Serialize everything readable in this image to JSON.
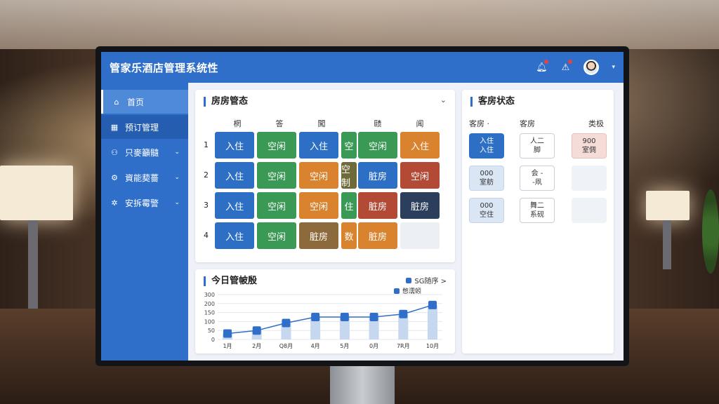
{
  "app": {
    "title": "管家乐酒店管理系统性"
  },
  "topbar": {
    "icons": [
      "bell-icon",
      "alarm-icon"
    ]
  },
  "sidebar": {
    "items": [
      {
        "icon": "home-icon",
        "label": "首页",
        "glyph": "⌂"
      },
      {
        "icon": "grid-icon",
        "label": "预订管理",
        "glyph": "▦"
      },
      {
        "icon": "users-icon",
        "label": "只麥籲髓",
        "glyph": "⚇"
      },
      {
        "icon": "settings-icon",
        "label": "資能葜薔",
        "glyph": "⚙"
      },
      {
        "icon": "gear-icon",
        "label": "安拆霉警",
        "glyph": "✲"
      }
    ]
  },
  "rooms": {
    "title": "房房管态",
    "columns": [
      "棢",
      "答",
      "闖",
      "赜",
      "闻"
    ],
    "rows": [
      {
        "num": "1",
        "cells": [
          "入住",
          "空闲",
          "入住",
          "空",
          "空闲",
          "入住"
        ]
      },
      {
        "num": "2",
        "cells": [
          "入住",
          "空闲",
          "空闲",
          "空制",
          "脏房",
          "空闲"
        ]
      },
      {
        "num": "3",
        "cells": [
          "入住",
          "空闲",
          "空闲",
          "住",
          "脏房",
          "脏房"
        ]
      },
      {
        "num": "4",
        "cells": [
          "入住",
          "空闲",
          "脏房",
          "数",
          "脏房",
          ""
        ]
      }
    ]
  },
  "status": {
    "title": "客房状态",
    "headers": [
      "客房 ·",
      "客房",
      "类极"
    ],
    "chips": [
      {
        "l1": "入住",
        "l2": "入住"
      },
      {
        "l1": "人二",
        "l2": "脚"
      },
      {
        "l1": "900",
        "l2": "室倜"
      },
      {
        "l1": "000",
        "l2": "室舫"
      },
      {
        "l1": "会 -",
        "l2": "-凧"
      },
      {
        "l1": "000",
        "l2": "空住"
      },
      {
        "l1": "舞二",
        "l2": "系砚"
      }
    ]
  },
  "chart": {
    "title": "今日管帔殷",
    "legend": "SG随序 >",
    "legend2": "憋濡蚓",
    "colors": {
      "line": "#2f6fc9",
      "bar": "#c6d8f0"
    }
  },
  "chart_data": {
    "type": "line",
    "title": "今日管帔殷",
    "categories": [
      "1月",
      "2月",
      "Q8月",
      "4月",
      "5月",
      "0月",
      "7R月",
      "10月"
    ],
    "yticks": [
      "300",
      "200",
      "150",
      "100",
      "50",
      "0"
    ],
    "ylim": [
      0,
      300
    ],
    "values": [
      40,
      60,
      110,
      150,
      150,
      150,
      170,
      230
    ],
    "grid": true
  }
}
